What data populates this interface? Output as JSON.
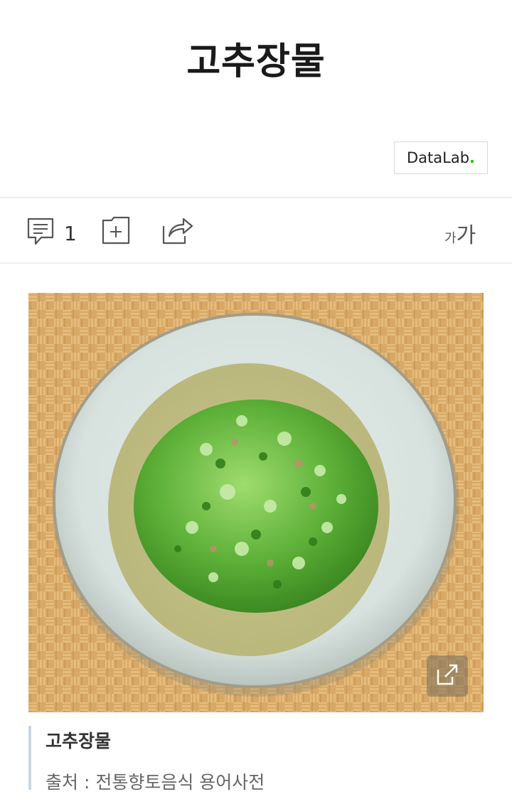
{
  "article": {
    "title": "고추장물"
  },
  "badge": {
    "label_main": "DataLab",
    "label_dot": "."
  },
  "toolbar": {
    "comment_count": "1",
    "font_small": "가",
    "font_big": "가"
  },
  "image": {
    "caption_title": "고추장물",
    "caption_source": "출처 : 전통향토음식 용어사전"
  },
  "colors": {
    "accent_green": "#1ec800",
    "caption_bar": "#c9d6e3"
  }
}
